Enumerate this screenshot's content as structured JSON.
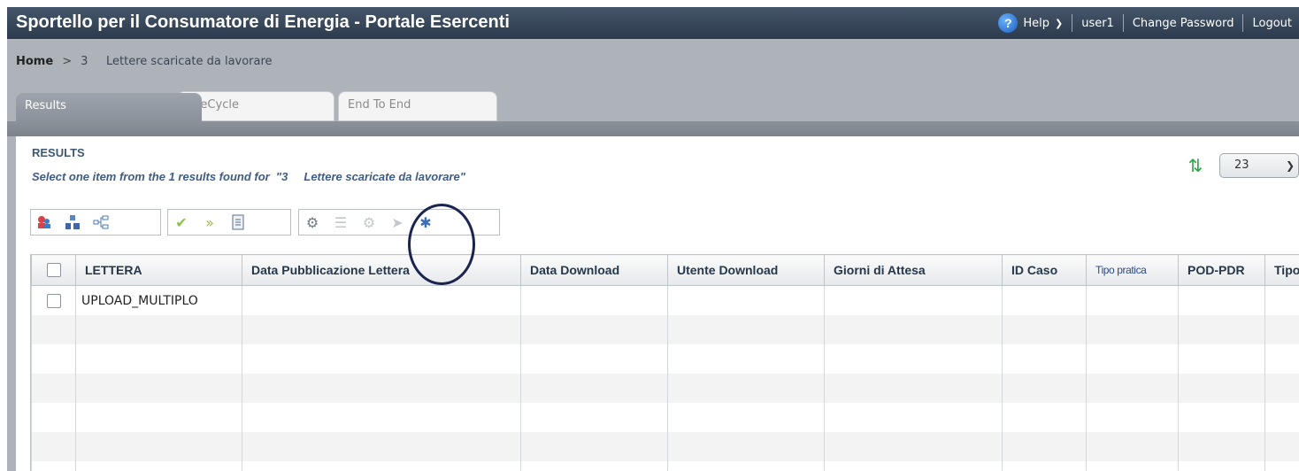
{
  "header": {
    "title": "Sportello per il Consumatore di Energia - Portale Esercenti",
    "help_icon": "?",
    "help_label": "Help",
    "user": "user1",
    "change_password": "Change Password",
    "logout": "Logout"
  },
  "breadcrumb": {
    "home": "Home",
    "separator": ">",
    "current": "3     Lettere scaricate da lavorare"
  },
  "tabs": [
    {
      "label": "Results",
      "active": true
    },
    {
      "label": "LifeCycle",
      "active": false
    },
    {
      "label": "End To End",
      "active": false
    }
  ],
  "results": {
    "heading": "RESULTS",
    "subtitle": "Select one item from the 1 results found for  \"3     Lettere scaricate da lavorare\"",
    "page_size": "23"
  },
  "toolbar_icons": [
    "users-filter-icon",
    "hierarchy-icon",
    "tree-icon",
    "approve-check-icon",
    "double-check-icon",
    "document-icon",
    "gear-run-icon",
    "disabled-doc-icon",
    "disabled-gear-icon",
    "disabled-forward-icon",
    "settings-star-icon"
  ],
  "table": {
    "columns": [
      "LETTERA",
      "Data Pubblicazione Lettera",
      "Data Download",
      "Utente Download",
      "Giorni di Attesa",
      "ID Caso",
      "Tipo pratica",
      "POD-PDR",
      "Tipo"
    ],
    "rows": [
      [
        "UPLOAD_MULTIPLO",
        "",
        "",
        "",
        "",
        "",
        "",
        "",
        ""
      ]
    ]
  },
  "colors": {
    "title_bar": "#2f3e50",
    "header_grey": "#aeb3ba",
    "heading_blue": "#3e5874",
    "annotation": "#1b2450"
  }
}
